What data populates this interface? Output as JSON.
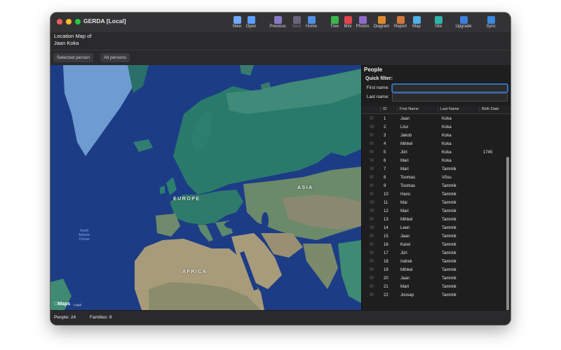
{
  "window": {
    "title": "GERDA [Local]"
  },
  "toolbar": [
    {
      "label": "New",
      "icon": "new-document-icon",
      "color": "#6fa8ff",
      "enabled": true
    },
    {
      "label": "Open",
      "icon": "open-folder-icon",
      "color": "#5aa0ff",
      "enabled": true
    },
    {
      "label": "Previous",
      "icon": "previous-icon",
      "color": "#8a78c9",
      "enabled": true
    },
    {
      "label": "Next",
      "icon": "next-icon",
      "color": "#6b6380",
      "enabled": false
    },
    {
      "label": "Home",
      "icon": "home-icon",
      "color": "#4f8fe8",
      "enabled": true
    },
    {
      "label": "Tree",
      "icon": "tree-icon",
      "color": "#3cb64a",
      "enabled": true
    },
    {
      "label": "Mini",
      "icon": "mini-tag-icon",
      "color": "#e0454a",
      "enabled": true
    },
    {
      "label": "Photos",
      "icon": "photos-icon",
      "color": "#8d6bc9",
      "enabled": true
    },
    {
      "label": "Diagram",
      "icon": "diagram-icon",
      "color": "#e08a2e",
      "enabled": true
    },
    {
      "label": "Report",
      "icon": "report-icon",
      "color": "#d0783a",
      "enabled": true
    },
    {
      "label": "Map",
      "icon": "map-icon",
      "color": "#4fb0e6",
      "enabled": true
    },
    {
      "label": "Site",
      "icon": "globe-icon",
      "color": "#2fb3a8",
      "enabled": true
    },
    {
      "label": "Upgrade",
      "icon": "upgrade-icon",
      "color": "#3d7fdc",
      "enabled": true
    },
    {
      "label": "Sync",
      "icon": "sync-icon",
      "color": "#3a86e0",
      "enabled": true
    }
  ],
  "location": {
    "title": "Location Map of",
    "person": "Jaan Koka"
  },
  "tabs": [
    "Selected person",
    "All persons"
  ],
  "map": {
    "labels": {
      "europe": "EUROPE",
      "asia": "ASIA",
      "africa": "AFRICA"
    },
    "ocean_line1": "North",
    "ocean_line2": "Atlantic",
    "ocean_line3": "Ocean",
    "brand": "Maps",
    "legal": "Legal"
  },
  "people_panel": {
    "title": "People",
    "quick_filter": "Quick filter:",
    "first_name_label": "First name:",
    "last_name_label": "Last name:",
    "first_name_value": "",
    "last_name_value": "",
    "columns": [
      "ID",
      "First Name",
      "Last Name",
      "Birth Date"
    ],
    "rows": [
      {
        "sex": "M",
        "id": "1",
        "first": "Jaan",
        "last": "Koka",
        "birth": ""
      },
      {
        "sex": "W",
        "id": "2",
        "first": "Liso",
        "last": "Koka",
        "birth": ""
      },
      {
        "sex": "M",
        "id": "3",
        "first": "Jakob",
        "last": "Koka",
        "birth": ""
      },
      {
        "sex": "M",
        "id": "4",
        "first": "Mihkel",
        "last": "Koka",
        "birth": ""
      },
      {
        "sex": "M",
        "id": "5",
        "first": "Jüri",
        "last": "Koka",
        "birth": "1745"
      },
      {
        "sex": "W",
        "id": "6",
        "first": "Mari",
        "last": "Koka",
        "birth": ""
      },
      {
        "sex": "W",
        "id": "7",
        "first": "Mari",
        "last": "Tammik",
        "birth": ""
      },
      {
        "sex": "M",
        "id": "8",
        "first": "Toomas",
        "last": "Võsu",
        "birth": ""
      },
      {
        "sex": "M",
        "id": "9",
        "first": "Toomas",
        "last": "Tammik",
        "birth": ""
      },
      {
        "sex": "M",
        "id": "10",
        "first": "Hans",
        "last": "Tammik",
        "birth": ""
      },
      {
        "sex": "W",
        "id": "11",
        "first": "Mai",
        "last": "Tammik",
        "birth": ""
      },
      {
        "sex": "W",
        "id": "12",
        "first": "Mari",
        "last": "Tammik",
        "birth": ""
      },
      {
        "sex": "M",
        "id": "13",
        "first": "Mihkel",
        "last": "Tammik",
        "birth": ""
      },
      {
        "sex": "W",
        "id": "14",
        "first": "Leen",
        "last": "Tammik",
        "birth": ""
      },
      {
        "sex": "M",
        "id": "15",
        "first": "Jaan",
        "last": "Tammik",
        "birth": ""
      },
      {
        "sex": "M",
        "id": "16",
        "first": "Karel",
        "last": "Tammik",
        "birth": ""
      },
      {
        "sex": "M",
        "id": "17",
        "first": "Jüri",
        "last": "Tammik",
        "birth": ""
      },
      {
        "sex": "M",
        "id": "18",
        "first": "Indrek",
        "last": "Tammik",
        "birth": ""
      },
      {
        "sex": "M",
        "id": "19",
        "first": "Mihkel",
        "last": "Tammik",
        "birth": ""
      },
      {
        "sex": "M",
        "id": "20",
        "first": "Jaan",
        "last": "Tammik",
        "birth": ""
      },
      {
        "sex": "M",
        "id": "21",
        "first": "Mart",
        "last": "Tammik",
        "birth": ""
      },
      {
        "sex": "M",
        "id": "22",
        "first": "Joosep",
        "last": "Tammik",
        "birth": ""
      }
    ]
  },
  "status": {
    "people": "People: 24",
    "families": "Families: 9"
  }
}
